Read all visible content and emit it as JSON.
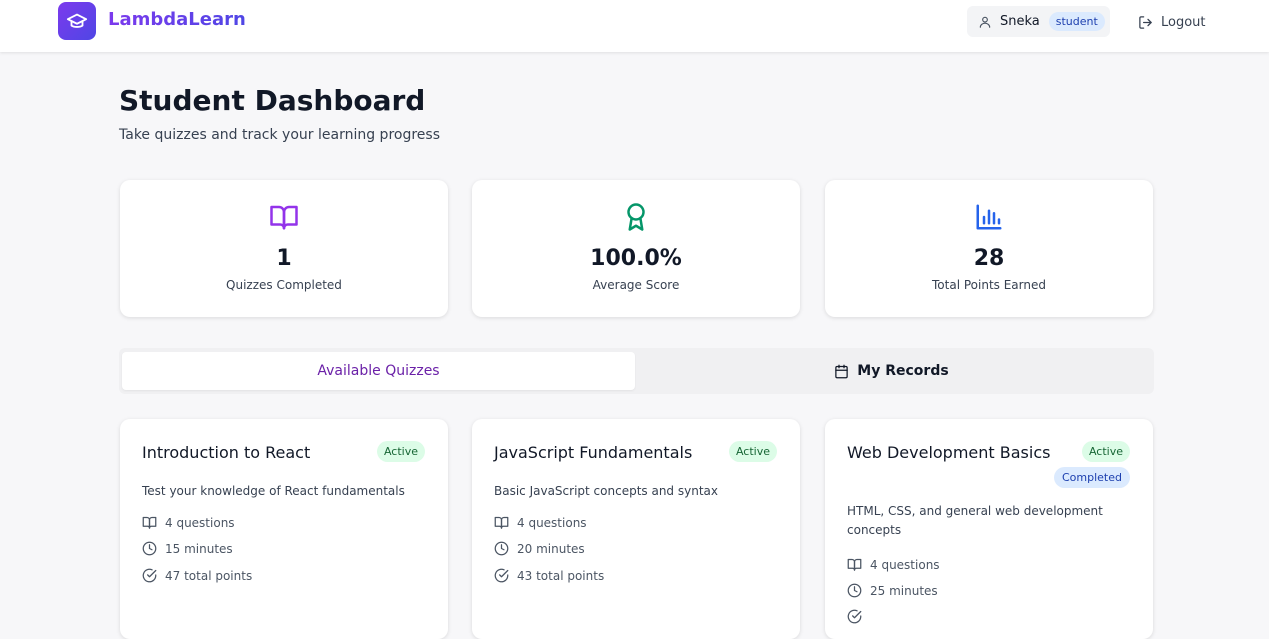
{
  "header": {
    "brand": "LambdaLearn",
    "user_name": "Sneka",
    "user_role": "student",
    "logout_label": "Logout"
  },
  "page": {
    "title": "Student Dashboard",
    "subtitle": "Take quizzes and track your learning progress"
  },
  "stats": [
    {
      "icon": "book-open-icon",
      "value": "1",
      "label": "Quizzes Completed",
      "color": "#9333ea"
    },
    {
      "icon": "award-icon",
      "value": "100.0%",
      "label": "Average Score",
      "color": "#059669"
    },
    {
      "icon": "bar-chart-icon",
      "value": "28",
      "label": "Total Points Earned",
      "color": "#2563eb"
    }
  ],
  "tabs": [
    {
      "label": "Available Quizzes",
      "active": true
    },
    {
      "label": "My Records",
      "icon": "calendar-icon",
      "active": false
    }
  ],
  "quizzes": [
    {
      "title": "Introduction to React",
      "status": "Active",
      "description": "Test your knowledge of React fundamentals",
      "questions": "4 questions",
      "duration": "15 minutes",
      "points": "47 total points"
    },
    {
      "title": "JavaScript Fundamentals",
      "status": "Active",
      "description": "Basic JavaScript concepts and syntax",
      "questions": "4 questions",
      "duration": "20 minutes",
      "points": "43 total points"
    },
    {
      "title": "Web Development Basics",
      "status": "Active",
      "completed": "Completed",
      "description": "HTML, CSS, and general web development concepts",
      "questions": "4 questions",
      "duration": "25 minutes",
      "points": ""
    }
  ],
  "colors": {
    "accent": "#6b21a8",
    "brand_gradient_start": "#7c3aed",
    "brand_gradient_end": "#4f46e5",
    "active_badge_bg": "#dcfce7",
    "completed_badge_bg": "#dbeafe"
  }
}
